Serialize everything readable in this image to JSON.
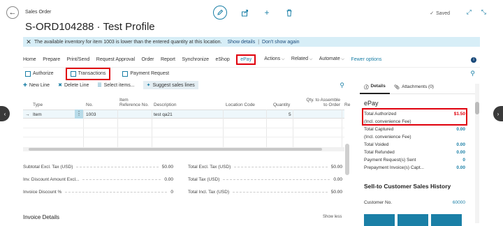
{
  "header": {
    "breadcrumb": "Sales Order",
    "title": "S-ORD104288 · Test Profile",
    "saved": "Saved"
  },
  "notification": {
    "message": "The available inventory for item 1003 is lower than the entered quantity at this location.",
    "show_details": "Show details",
    "dont_show": "Don't show again"
  },
  "actions": {
    "home": "Home",
    "prepare": "Prepare",
    "print_send": "Print/Send",
    "request_approval": "Request Approval",
    "order": "Order",
    "report": "Report",
    "synchronize": "Synchronize",
    "eshop": "eShop",
    "epay": "ePay",
    "actions": "Actions",
    "related": "Related",
    "automate": "Automate",
    "fewer": "Fewer options"
  },
  "subactions": {
    "authorize": "Authorize",
    "transactions": "Transactions",
    "payment_request": "Payment Request"
  },
  "lines_toolbar": {
    "new_line": "New Line",
    "delete_line": "Delete Line",
    "select_items": "Select items...",
    "suggest": "Suggest sales lines"
  },
  "grid": {
    "columns": {
      "type": "Type",
      "no": "No.",
      "item_ref": "Item Reference No.",
      "description": "Description",
      "location": "Location Code",
      "quantity": "Quantity",
      "qty_assemble": "Qty. to Assemble to Order",
      "re": "Re"
    },
    "row": {
      "arrow": "→",
      "type": "Item",
      "no": "1003",
      "description": "test qa21",
      "quantity": "5"
    }
  },
  "totals": {
    "subtotal_label": "Subtotal Excl. Tax (USD)",
    "subtotal_value": "50.00",
    "inv_discount_label": "Inv. Discount Amount Excl...",
    "inv_discount_value": "0.00",
    "inv_discount_pct_label": "Invoice Discount %",
    "inv_discount_pct_value": "0",
    "total_excl_label": "Total Excl. Tax (USD)",
    "total_excl_value": "50.00",
    "total_tax_label": "Total Tax (USD)",
    "total_tax_value": "0.00",
    "total_incl_label": "Total Incl. Tax (USD)",
    "total_incl_value": "50.00"
  },
  "invoice_details": "Invoice Details",
  "show_less": "Show less",
  "factbox": {
    "tab_details": "Details",
    "tab_attachments": "Attachments (0)",
    "title": "ePay",
    "rows": [
      {
        "label": "Total Authorized",
        "value": "$1.50"
      },
      {
        "label": "(Incl. convenience Fee)",
        "value": ""
      },
      {
        "label": "Total Captured",
        "value": "0.00"
      },
      {
        "label": "(Incl. convenience Fee)",
        "value": ""
      },
      {
        "label": "Total Voided",
        "value": "0.00"
      },
      {
        "label": "Total Refunded",
        "value": "0.00"
      },
      {
        "label": "Payment Request(s) Sent",
        "value": "0"
      },
      {
        "label": "Prepayment Invoice(s) Capt...",
        "value": "0.00"
      }
    ],
    "sell_title": "Sell-to Customer Sales History",
    "customer_label": "Customer No.",
    "customer_value": "60000"
  },
  "colors": {
    "accent": "#1a7fa6",
    "highlight": "#e0000c",
    "notification_bg": "#d7eef7"
  }
}
